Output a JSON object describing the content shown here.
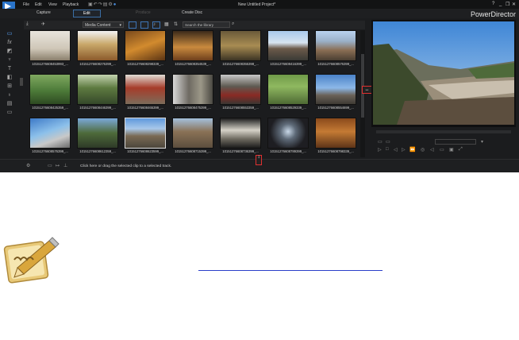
{
  "app": {
    "menu": [
      "File",
      "Edit",
      "View",
      "Playback"
    ],
    "window_title": "New Untitled Project*",
    "window_controls": [
      "?",
      "_",
      "❐",
      "✕"
    ],
    "brand": "PowerDirector",
    "modes": [
      {
        "label": "Capture",
        "state": "normal"
      },
      {
        "label": "Edit",
        "state": "active"
      },
      {
        "label": "Produce",
        "state": "disabled"
      },
      {
        "label": "Create Disc",
        "state": "normal"
      }
    ],
    "library": {
      "content_select": "Media Content",
      "search_placeholder": "Search the library"
    },
    "hint_text": "Click here or drag the selected clip to a selected track.",
    "preview_timecode": "",
    "colors": {
      "accent": "#3a6ea5",
      "highlight": "#e03030"
    }
  },
  "media": [
    {
      "name": "10151276608453993_..."
    },
    {
      "name": "10151276608276399_..."
    },
    {
      "name": "10151276608298339_..."
    },
    {
      "name": "10151276608354539_..."
    },
    {
      "name": "10151276608355398_..."
    },
    {
      "name": "10151276608416399_..."
    },
    {
      "name": "10151276608425359_..."
    },
    {
      "name": "10151276608446399_..."
    },
    {
      "name": "10151276608465399_..."
    },
    {
      "name": "10151276608475399_..."
    },
    {
      "name": "10151276608553359_..."
    },
    {
      "name": "10151276608529339_..."
    },
    {
      "name": "10151276608554699_..."
    },
    {
      "name": "10151276608576399_..."
    },
    {
      "name": "10151276608576399_..."
    },
    {
      "name": "10151276608612359_..."
    },
    {
      "name": "10151276608623599_..."
    },
    {
      "name": "10151276608715399_..."
    },
    {
      "name": "10151276608736399_..."
    },
    {
      "name": "10151276608789399_..."
    },
    {
      "name": "10151276608798339_..."
    }
  ]
}
